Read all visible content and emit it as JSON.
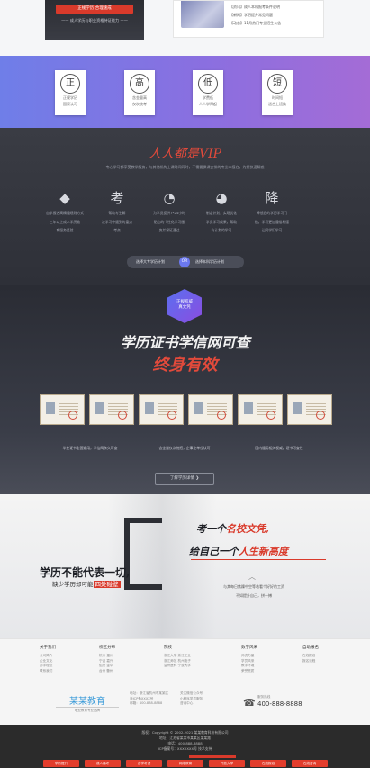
{
  "top": {
    "button_label": "正规学历 合理速成",
    "left_caption": "—— 成人学历与职业资格持证能力 ——",
    "news": [
      "【资讯】成人本科报考条件说明",
      "【新闻】学历提升常见问题",
      "【动态】11月热门专业招生公告"
    ]
  },
  "features": [
    {
      "glyph": "正",
      "line1": "正规学历",
      "line2": "国家认可"
    },
    {
      "glyph": "高",
      "line1": "含金量高",
      "line2": "仅次统考"
    },
    {
      "glyph": "低",
      "line1": "学费低",
      "line2": "人人学得起"
    },
    {
      "glyph": "短",
      "line1": "时间短",
      "line2": "适合上班族"
    }
  ],
  "vip": {
    "title": "人人都是VIP",
    "description": "专心学习都享受教学服务，与其他机构上课时间同时，不需要换课安排的专业本报名，为您快速解惑",
    "items": [
      {
        "icon": "diamond-icon",
        "glyph": "◆",
        "line1": "自学报名高精通规则方式",
        "line2": "三年以上成人学历教",
        "line3": "育服务经验"
      },
      {
        "icon": "kao-icon",
        "glyph": "考",
        "line1": "帮助考生解",
        "line2": "决学习中遇到的重点",
        "line3": "考点"
      },
      {
        "icon": "clock-icon",
        "glyph": "◔",
        "line1": "为学员提供7*24小时",
        "line2": "贴心的个性化学习服",
        "line3": "务并保证通过"
      },
      {
        "icon": "pie-icon",
        "glyph": "◕",
        "line1": "制定计划，实现优化",
        "line2": "学员学习成果，帮助",
        "line3": "有计划的学习"
      },
      {
        "icon": "jiang-icon",
        "glyph": "降",
        "line1": "降低旧的学历学习门",
        "line2": "槛，学习更加通俗易懂",
        "line3": "让同学们学习"
      }
    ],
    "toggle_left": "选择大专学历计划",
    "toggle_or": "OR",
    "toggle_right": "选择本科学历计划"
  },
  "cert": {
    "badge": "正规权威真文凭",
    "line1": "学历证书学信网可查",
    "line2": "终身有效",
    "captions": [
      "毕业证书全国通用，学信网永久可查",
      "含金量仅次统招，企事业单位认可",
      "国内通用相关权威，证书可查性"
    ],
    "learn_more": "了解学历详情 ❯"
  },
  "slogan": {
    "left_big": "学历不能代表一切,",
    "left_small_pre": "缺少学历却可能",
    "left_small_highlight": "四处碰壁",
    "right1_pre": "考一个",
    "right1_em": "名校文凭,",
    "right2_pre": "给自己一个",
    "right2_em": "人生新高度",
    "small1": "与其每日焦躁中空等着看个好好的工资",
    "small2": "不如提升自己，拼一搏"
  },
  "footer": {
    "columns": [
      {
        "title": "关于我们",
        "items": [
          "公司简介",
          "企业文化",
          "办学理念",
          "联系我们"
        ]
      },
      {
        "title": "校区分布",
        "items": [
          "杭州    温州",
          "宁波    嘉兴",
          "绍兴    金华",
          "台州    衢州"
        ]
      },
      {
        "title": "院校",
        "items": [
          "浙江大学    浙江工业",
          "浙江师范    杭州电子",
          "温州医科    宁波大学"
        ]
      },
      {
        "title": "数学风采",
        "items": [
          "师资力量",
          "学员风采",
          "教学环境",
          "荣誉资质"
        ]
      },
      {
        "title": "自助报名",
        "items": [
          "在线报名",
          "报名流程"
        ]
      }
    ],
    "logo_name": "某某教育",
    "logo_sub": "职业教育专业品牌",
    "notes1": [
      "地址：浙江省杭州市某某区",
      "浙ICP备XXXX号",
      "邮箱：400-888-8888"
    ],
    "notes2": [
      "关注微信公众号",
      "小程序学员服务",
      "咨询中心"
    ],
    "phone_label": "服务热线",
    "phone": "400-888-8888"
  },
  "bottom": {
    "lines": [
      "版权：Copyright © 2002-2021 某某教育科技有限公司",
      "地址：江苏省某某市某某区某某路",
      "电话：400-888-8888",
      "ICP备案号：XXXXXXX号 技术支持"
    ],
    "nav": [
      "学历提升",
      "成人高考",
      "自学考试",
      "网络教育",
      "开放大学",
      "在线报名",
      "在线咨询"
    ]
  }
}
